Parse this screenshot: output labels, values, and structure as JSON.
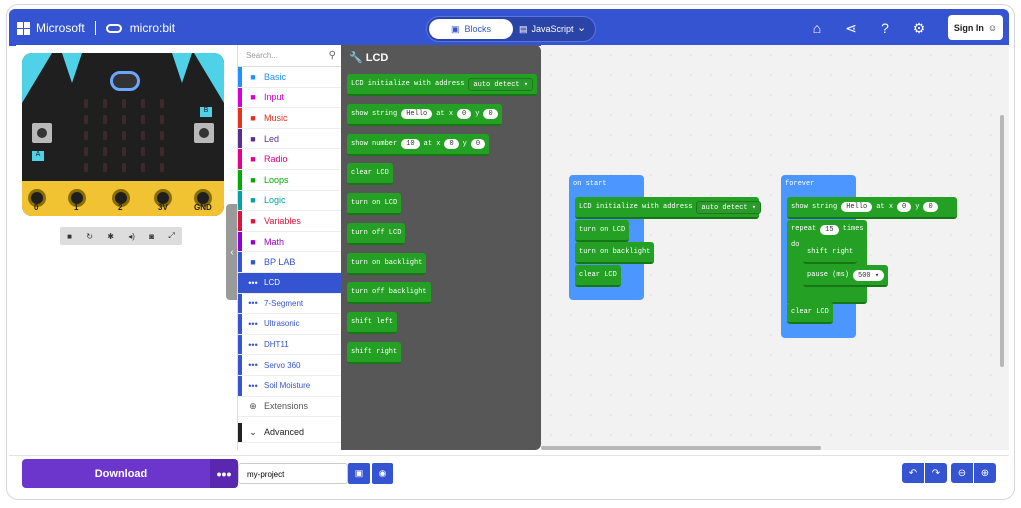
{
  "brand": {
    "microsoft": "Microsoft",
    "microbit": "micro:bit"
  },
  "mode": {
    "blocks": "Blocks",
    "javascript": "JavaScript"
  },
  "topbar": {
    "signin": "Sign In",
    "home_icon": "home-icon",
    "share_icon": "share-icon",
    "help_icon": "help-icon",
    "settings_icon": "gear-icon"
  },
  "simulator": {
    "pins": [
      "0",
      "1",
      "2",
      "3V",
      "GND"
    ],
    "button_a": "A",
    "button_b": "B",
    "controls": [
      "stop-icon",
      "restart-icon",
      "debug-icon",
      "mute-icon",
      "screenshot-icon",
      "fullscreen-icon"
    ]
  },
  "toolbox": {
    "search_placeholder": "Search...",
    "categories": [
      {
        "label": "Basic",
        "color": "#1e90ff",
        "icon": "grid-icon"
      },
      {
        "label": "Input",
        "color": "#d400d4",
        "icon": "input-icon"
      },
      {
        "label": "Music",
        "color": "#e63022",
        "icon": "headphones-icon"
      },
      {
        "label": "Led",
        "color": "#5c2d91",
        "icon": "toggle-icon"
      },
      {
        "label": "Radio",
        "color": "#e3008c",
        "icon": "signal-icon"
      },
      {
        "label": "Loops",
        "color": "#00aa00",
        "icon": "loop-icon"
      },
      {
        "label": "Logic",
        "color": "#00a4a6",
        "icon": "shuffle-icon"
      },
      {
        "label": "Variables",
        "color": "#dc143c",
        "icon": "list-icon"
      },
      {
        "label": "Math",
        "color": "#9400d3",
        "icon": "calculator-icon"
      },
      {
        "label": "BP LAB",
        "color": "#3454d1",
        "icon": "wrench-icon"
      }
    ],
    "subcategories": [
      "LCD",
      "7-Segment",
      "Ultrasonic",
      "DHT11",
      "Servo 360",
      "Soil Moisture"
    ],
    "extensions": "Extensions",
    "advanced": "Advanced"
  },
  "flyout": {
    "title": "LCD",
    "blocks": [
      {
        "text": "LCD initialize with address",
        "dropdown": "auto detect ▾"
      },
      {
        "text": "show string",
        "arg1": "Hello",
        "x": "at x",
        "xval": "0",
        "y": "y",
        "yval": "0"
      },
      {
        "text": "show number",
        "arg1": "10",
        "x": "at x",
        "xval": "0",
        "y": "y",
        "yval": "0"
      },
      {
        "text": "clear LCD"
      },
      {
        "text": "turn on LCD"
      },
      {
        "text": "turn off LCD"
      },
      {
        "text": "turn on backlight"
      },
      {
        "text": "turn off backlight"
      },
      {
        "text": "shift left"
      },
      {
        "text": "shift right"
      }
    ]
  },
  "workspace": {
    "on_start": {
      "label": "on start",
      "init": "LCD initialize with address",
      "init_dd": "auto detect ▾",
      "b1": "turn on LCD",
      "b2": "turn on backlight",
      "b3": "clear LCD"
    },
    "forever": {
      "label": "forever",
      "show": "show string",
      "show_arg": "Hello",
      "show_x": "at x",
      "show_xval": "0",
      "show_y": "y",
      "show_yval": "0",
      "repeat": "repeat",
      "repeat_n": "15",
      "times": "times",
      "do": "do",
      "shift": "shift right",
      "pause": "pause (ms)",
      "pause_val": "500 ▾",
      "clear": "clear LCD"
    }
  },
  "bottom": {
    "download": "Download",
    "more": "•••",
    "project_name": "my-project",
    "save_icon": "save-icon",
    "github_icon": "github-icon",
    "undo_icon": "undo-icon",
    "redo_icon": "redo-icon",
    "zoom_out_icon": "zoom-out-icon",
    "zoom_in_icon": "zoom-in-icon"
  }
}
